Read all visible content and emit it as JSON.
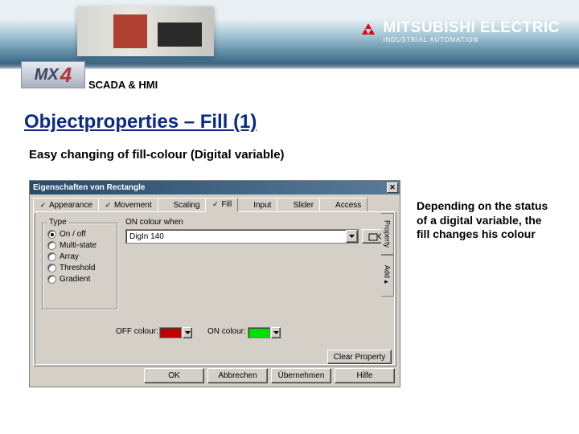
{
  "brand": {
    "name": "MITSUBISHI ELECTRIC",
    "sub": "INDUSTRIAL AUTOMATION"
  },
  "scada_label": "SCADA & HMI",
  "mx4": {
    "mx": "MX",
    "four": "4"
  },
  "title": "Objectproperties – Fill (1)",
  "subtitle": "Easy changing of fill-colour (Digital variable)",
  "side_note": "Depending on the status of a digital variable, the fill changes his colour",
  "dialog": {
    "title": "Eigenschaften von Rectangle",
    "tabs": {
      "appearance": "Appearance",
      "movement": "Movement",
      "scaling": "Scaling",
      "fill": "Fill",
      "input": "Input",
      "slider": "Slider",
      "access": "Access"
    },
    "type_group": {
      "label": "Type",
      "options": [
        "On / off",
        "Multi-state",
        "Array",
        "Threshold",
        "Gradient"
      ],
      "selected": 0
    },
    "on_colour_label": "ON colour when",
    "combo_value": "DigIn 140",
    "side_tabs": [
      "Property",
      "Add▸"
    ],
    "off_label": "OFF colour:",
    "on_label": "ON colour:",
    "off_colour": "#c00000",
    "on_colour": "#00e000",
    "browse_icon": "⋯",
    "clear_btn": "Clear Property",
    "buttons": {
      "ok": "OK",
      "cancel": "Abbrechen",
      "apply": "Übernehmen",
      "help": "Hilfe"
    }
  }
}
